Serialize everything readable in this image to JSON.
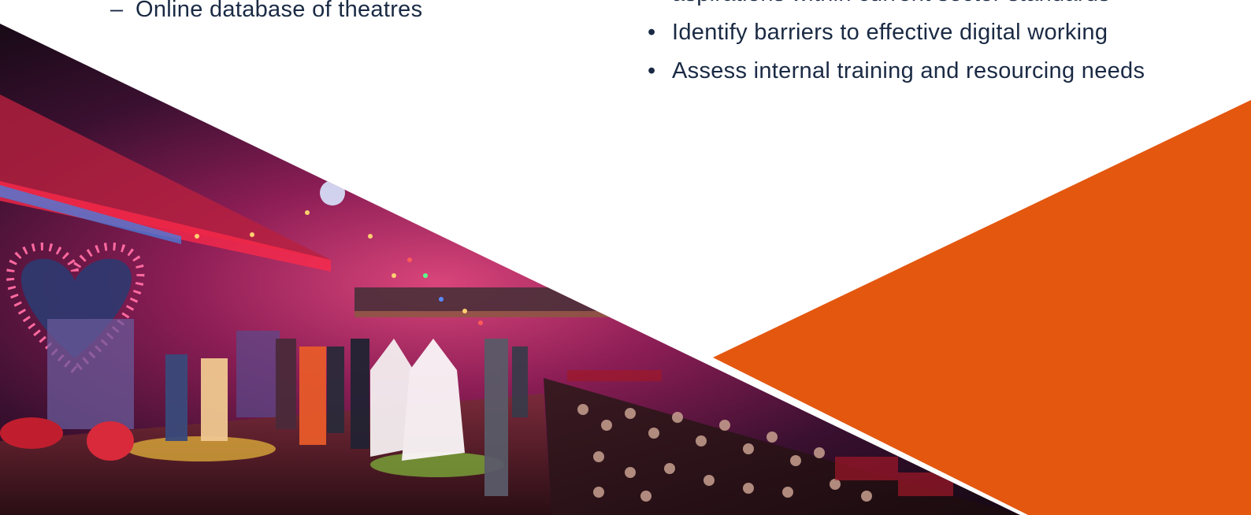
{
  "left_list": {
    "items": [
      {
        "marker": "–",
        "text": "Online database of theatres"
      }
    ]
  },
  "right_list": {
    "items": [
      {
        "marker": "",
        "text": "aspirations within current sector standards"
      },
      {
        "marker": "•",
        "text": "Identify barriers to effective digital working"
      },
      {
        "marker": "•",
        "text": "Assess internal training and resourcing needs"
      }
    ]
  },
  "photo": {
    "subject": "theatre-performance-photo"
  },
  "colors": {
    "text": "#1a2a44",
    "accent_orange": "#e4570f",
    "background": "#ffffff"
  }
}
